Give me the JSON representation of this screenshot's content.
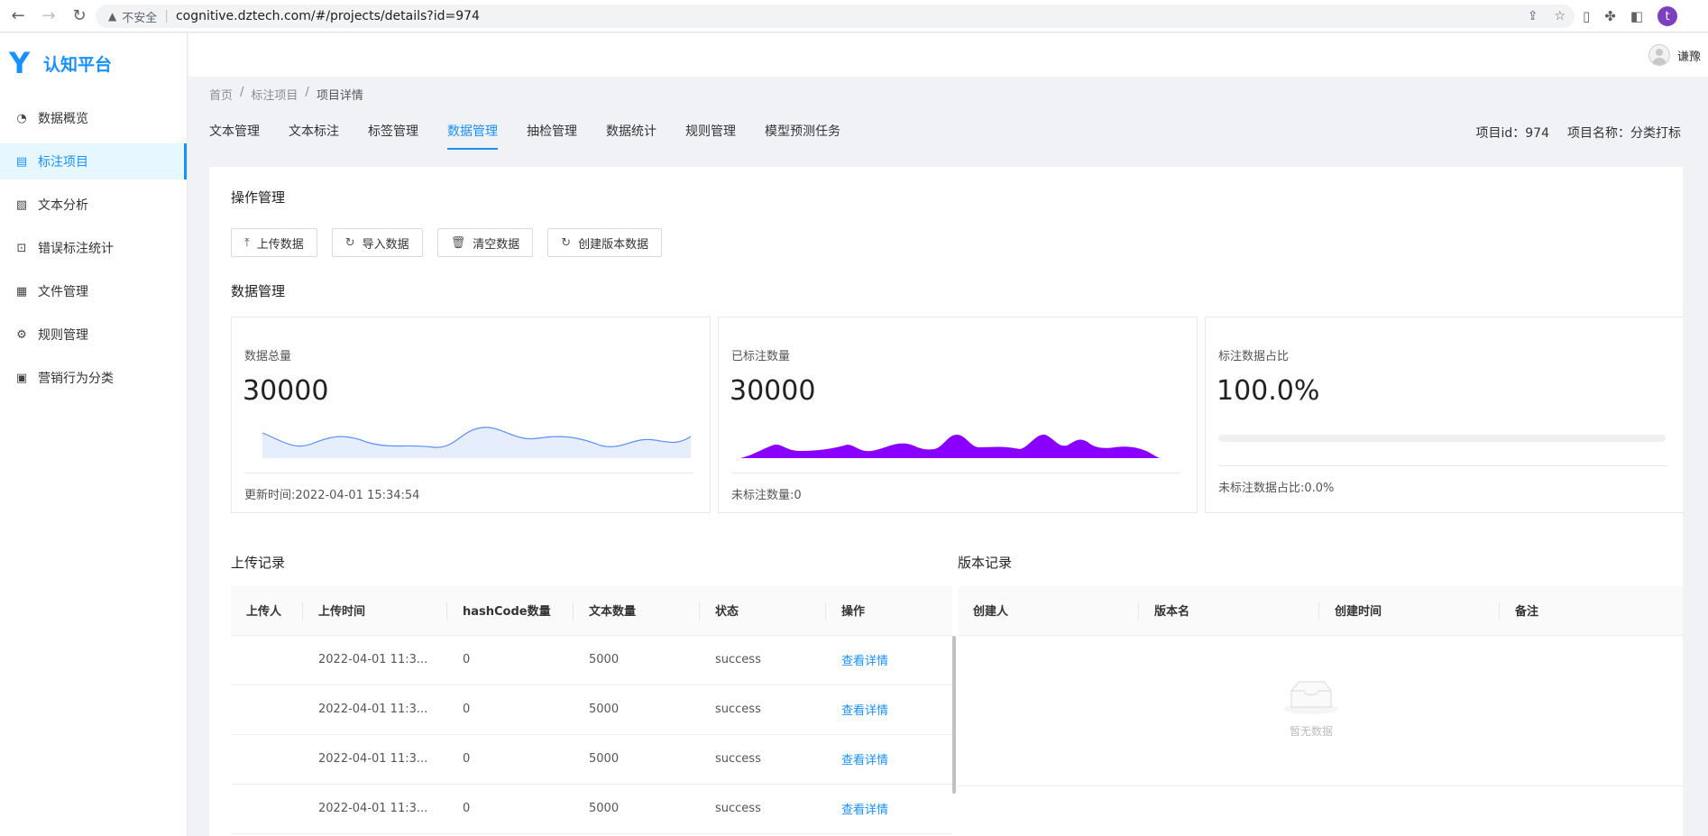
{
  "browser": {
    "insecure_label": "不安全",
    "url": "cognitive.dztech.com/#/projects/details?id=974",
    "profile_letter": "t"
  },
  "app": {
    "logo_mark": "Y",
    "title": "认知平台"
  },
  "sidebar": {
    "items": [
      {
        "label": "数据概览",
        "icon": "dashboard-icon"
      },
      {
        "label": "标注项目",
        "icon": "clipboard-icon"
      },
      {
        "label": "文本分析",
        "icon": "analysis-icon"
      },
      {
        "label": "错误标注统计",
        "icon": "error-stats-icon"
      },
      {
        "label": "文件管理",
        "icon": "file-icon"
      },
      {
        "label": "规则管理",
        "icon": "gear-icon"
      },
      {
        "label": "营销行为分类",
        "icon": "category-icon"
      }
    ]
  },
  "header": {
    "username": "谦豫"
  },
  "breadcrumb": [
    "首页",
    "/",
    "标注项目",
    "/",
    "项目详情"
  ],
  "tabs": [
    "文本管理",
    "文本标注",
    "标签管理",
    "数据管理",
    "抽检管理",
    "数据统计",
    "规则管理",
    "模型预测任务"
  ],
  "active_tab": "数据管理",
  "project": {
    "id_label": "项目id：974",
    "name_label": "项目名称：分类打标"
  },
  "ops": {
    "title": "操作管理",
    "buttons": [
      "上传数据",
      "导入数据",
      "清空数据",
      "创建版本数据"
    ]
  },
  "data_mgmt": {
    "title": "数据管理",
    "cards": [
      {
        "label": "数据总量",
        "value": "30000",
        "footer": "更新时间:2022-04-01 15:34:54"
      },
      {
        "label": "已标注数量",
        "value": "30000",
        "footer": "未标注数量:0"
      },
      {
        "label": "标注数据占比",
        "value": "100.0%",
        "footer": "未标注数据占比:0.0%"
      }
    ],
    "colors": {
      "line": "#5b8ff9",
      "area": "#8a00ff"
    }
  },
  "upload_records": {
    "title": "上传记录",
    "columns": [
      "上传人",
      "上传时间",
      "hashCode数量",
      "文本数量",
      "状态",
      "操作"
    ],
    "rows": [
      {
        "uploader": "",
        "time": "2022-04-01 11:3...",
        "hash": "0",
        "count": "5000",
        "status": "success",
        "action": "查看详情"
      },
      {
        "uploader": "",
        "time": "2022-04-01 11:3...",
        "hash": "0",
        "count": "5000",
        "status": "success",
        "action": "查看详情"
      },
      {
        "uploader": "",
        "time": "2022-04-01 11:3...",
        "hash": "0",
        "count": "5000",
        "status": "success",
        "action": "查看详情"
      },
      {
        "uploader": "",
        "time": "2022-04-01 11:3...",
        "hash": "0",
        "count": "5000",
        "status": "success",
        "action": "查看详情"
      }
    ]
  },
  "version_records": {
    "title": "版本记录",
    "columns": [
      "创建人",
      "版本名",
      "创建时间",
      "备注"
    ],
    "empty_text": "暂无数据"
  }
}
